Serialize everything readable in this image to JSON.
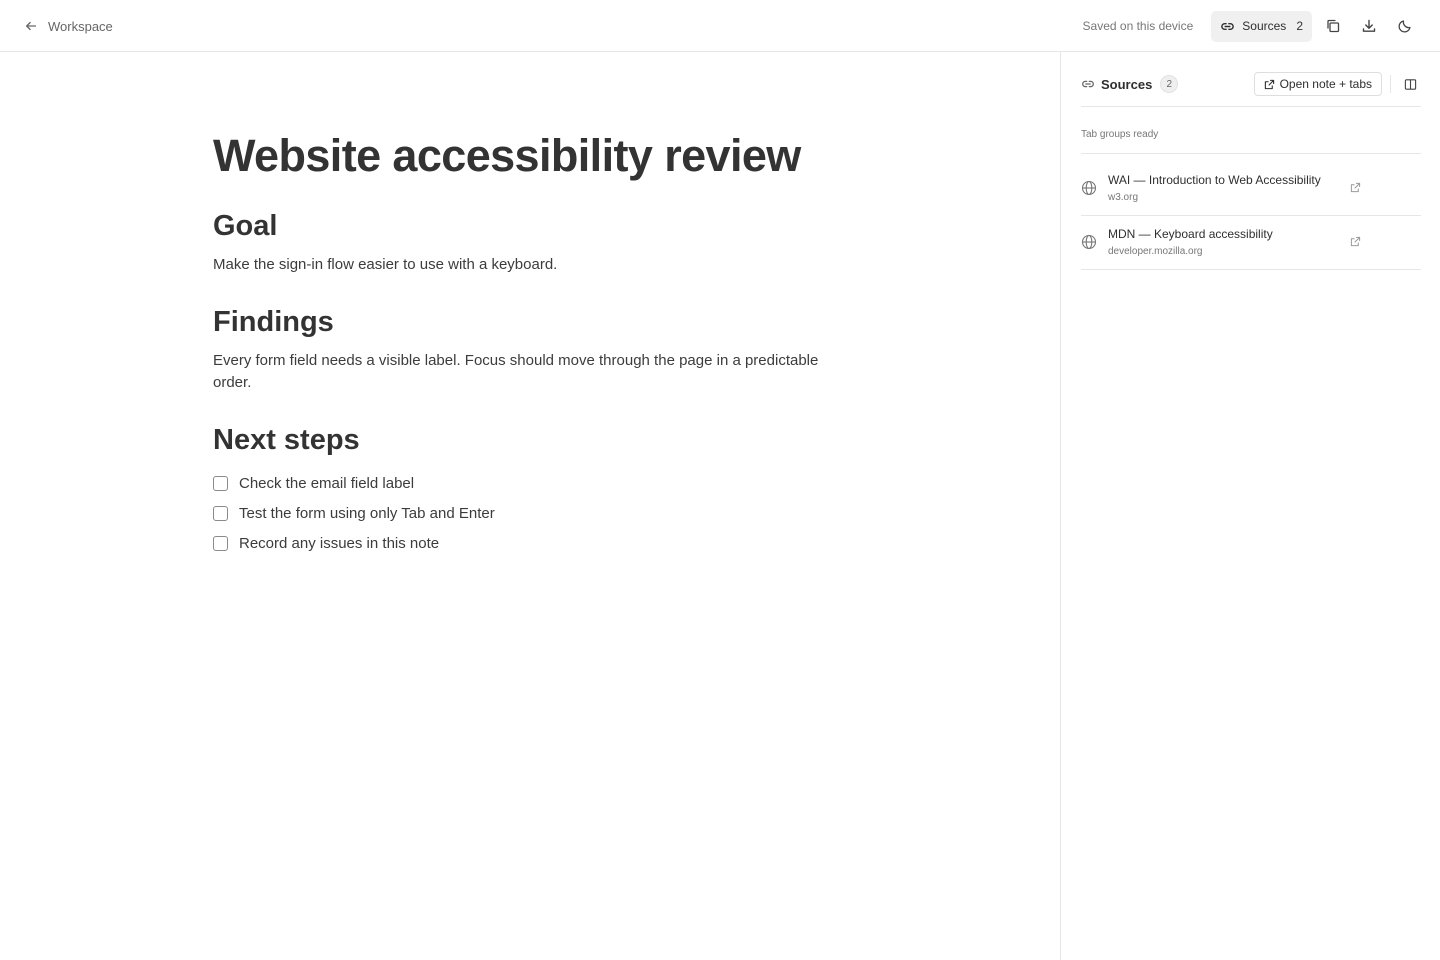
{
  "header": {
    "back_label": "Workspace",
    "saved_status": "Saved on this device",
    "sources_label": "Sources",
    "sources_count": "2",
    "icons": [
      "arrow-left-icon",
      "link-icon",
      "copy-icon",
      "download-icon",
      "moon-icon"
    ]
  },
  "document": {
    "title": "Website accessibility review",
    "sections": [
      {
        "heading": "Goal",
        "body": "Make the sign-in flow easier to use with a keyboard."
      },
      {
        "heading": "Findings",
        "body": "Every form field needs a visible label. Focus should move through the page in a predictable order."
      },
      {
        "heading": "Next steps"
      }
    ],
    "tasks": [
      {
        "label": "Check the email field label",
        "checked": false
      },
      {
        "label": "Test the form using only Tab and Enter",
        "checked": false
      },
      {
        "label": "Record any issues in this note",
        "checked": false
      }
    ]
  },
  "sidebar": {
    "title": "Sources",
    "count": "2",
    "open_button_label": "Open note + tabs",
    "group_label": "Tab groups ready",
    "sources": [
      {
        "title": "WAI — Introduction to Web Accessibility",
        "domain": "w3.org"
      },
      {
        "title": "MDN — Keyboard accessibility",
        "domain": "developer.mozilla.org"
      }
    ]
  },
  "colors": {
    "text": "#2f2f2f",
    "muted": "#777777",
    "border": "#e6e6e6",
    "button_bg": "#f0f0f0"
  }
}
